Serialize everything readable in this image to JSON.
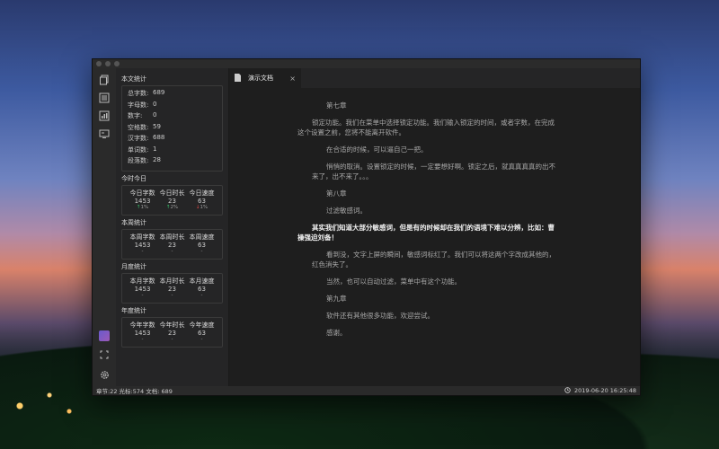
{
  "sidebar": {
    "text_stats": {
      "title": "本文统计",
      "rows": [
        {
          "label": "总字数:",
          "value": "689"
        },
        {
          "label": "字母数:",
          "value": "0"
        },
        {
          "label": "数字:",
          "value": "0"
        },
        {
          "label": "空格数:",
          "value": "59"
        },
        {
          "label": "汉字数:",
          "value": "688"
        },
        {
          "label": "单词数:",
          "value": "1"
        },
        {
          "label": "段落数:",
          "value": "28"
        }
      ]
    },
    "today": {
      "title": "今时今日",
      "cols": [
        {
          "label": "今日字数",
          "value": "1453",
          "delta": "1%",
          "dir": "up"
        },
        {
          "label": "今日时长",
          "value": "23",
          "delta": "2%",
          "dir": "up"
        },
        {
          "label": "今日速度",
          "value": "63",
          "delta": "1%",
          "dir": "down"
        }
      ]
    },
    "week": {
      "title": "本周统计",
      "cols": [
        {
          "label": "本周字数",
          "value": "1453",
          "sub": "-"
        },
        {
          "label": "本周时长",
          "value": "23",
          "sub": "-"
        },
        {
          "label": "本周速度",
          "value": "63",
          "sub": "-"
        }
      ]
    },
    "month": {
      "title": "月度统计",
      "cols": [
        {
          "label": "本月字数",
          "value": "1453",
          "sub": "-"
        },
        {
          "label": "本月时长",
          "value": "23",
          "sub": "-"
        },
        {
          "label": "本月速度",
          "value": "63",
          "sub": "-"
        }
      ]
    },
    "year": {
      "title": "年度统计",
      "cols": [
        {
          "label": "今年字数",
          "value": "1453",
          "sub": "-"
        },
        {
          "label": "今年时长",
          "value": "23",
          "sub": "-"
        },
        {
          "label": "今年速度",
          "value": "63",
          "sub": "-"
        }
      ]
    }
  },
  "tab": {
    "label": "演示文档",
    "close": "×"
  },
  "document": {
    "paragraphs": [
      {
        "text": "第七章",
        "style": "normal"
      },
      {
        "text": "锁定功能。我们在菜单中选择锁定功能。我们输入锁定的时间，或者字数，在完成这个设置之前，您将不能离开软件。",
        "style": "hang"
      },
      {
        "text": "在合适的时候，可以逼自己一把。",
        "style": "normal"
      },
      {
        "text": "悄悄的取消。设置锁定的时候，一定要想好啊。锁定之后，就真真真真的出不来了，出不来了。。。",
        "style": "normal"
      },
      {
        "text": "第八章",
        "style": "normal"
      },
      {
        "text": "过滤敏感词。",
        "style": "normal"
      },
      {
        "text": "其实我们知道大部分敏感词，但是有的时候却在我们的语境下难以分辨，比如：曹操强迫刘备！",
        "style": "bold"
      },
      {
        "text": "看到没，文字上屏的瞬间，敏感词标红了。我们可以将这两个字改成其他的，红色消失了。",
        "style": "normal"
      },
      {
        "text": "当然，也可以自动过滤，菜单中有这个功能。",
        "style": "normal"
      },
      {
        "text": "第九章",
        "style": "normal"
      },
      {
        "text": "软件还有其他很多功能，欢迎尝试。",
        "style": "normal"
      },
      {
        "text": "感谢。",
        "style": "normal"
      }
    ]
  },
  "statusbar": {
    "left": "章节:22 光标:574 文档: 689",
    "datetime": "2019-06-20 16:25:48"
  },
  "colors": {
    "up": "#36c36a",
    "down": "#e04848"
  },
  "icons": {
    "activity": [
      "files-icon",
      "outline-icon",
      "stats-icon",
      "preview-icon"
    ],
    "bottom": [
      "theme-icon",
      "fullscreen-icon",
      "settings-icon"
    ]
  }
}
